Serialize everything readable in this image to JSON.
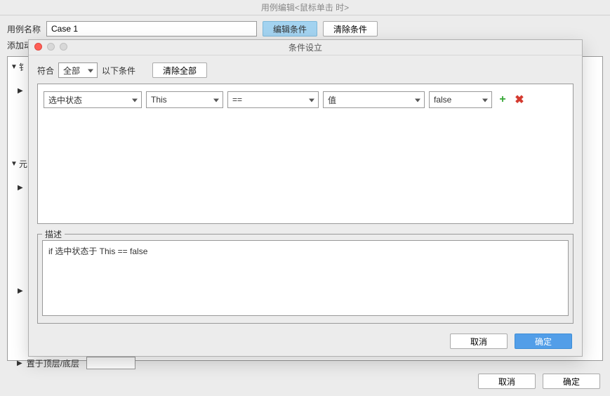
{
  "main": {
    "title": "用例编辑<鼠标单击 时>",
    "case_label": "用例名称",
    "case_value": "Case 1",
    "edit_condition": "编辑条件",
    "clear_condition": "清除条件",
    "add_action": "添加动",
    "bottom_left": "置于顶层/底层",
    "cancel": "取消",
    "ok": "确定"
  },
  "sidebar": {
    "item1": "钅",
    "item2": "元"
  },
  "modal": {
    "title": "条件设立",
    "match_prefix": "符合",
    "match_type": "全部",
    "match_suffix": "以下条件",
    "clear_all": "清除全部",
    "field": "选中状态",
    "target": "This",
    "operator": "==",
    "value_type": "值",
    "value": "false",
    "desc_label": "描述",
    "description": "if 选中状态于 This == false",
    "cancel": "取消",
    "ok": "确定"
  }
}
